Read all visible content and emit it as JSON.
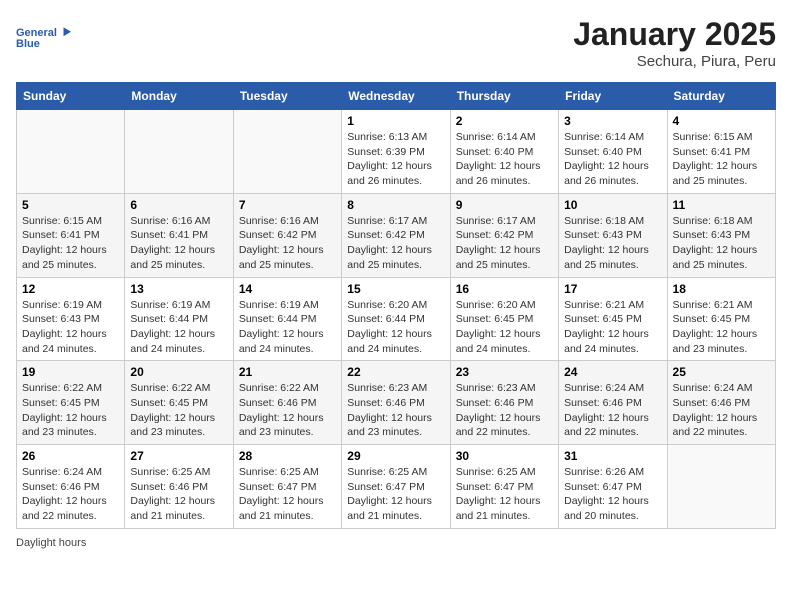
{
  "logo": {
    "line1": "General",
    "line2": "Blue"
  },
  "title": "January 2025",
  "subtitle": "Sechura, Piura, Peru",
  "weekdays": [
    "Sunday",
    "Monday",
    "Tuesday",
    "Wednesday",
    "Thursday",
    "Friday",
    "Saturday"
  ],
  "footer": {
    "daylight_label": "Daylight hours"
  },
  "weeks": [
    [
      {
        "day": "",
        "sunrise": "",
        "sunset": "",
        "daylight": ""
      },
      {
        "day": "",
        "sunrise": "",
        "sunset": "",
        "daylight": ""
      },
      {
        "day": "",
        "sunrise": "",
        "sunset": "",
        "daylight": ""
      },
      {
        "day": "1",
        "sunrise": "Sunrise: 6:13 AM",
        "sunset": "Sunset: 6:39 PM",
        "daylight": "Daylight: 12 hours and 26 minutes."
      },
      {
        "day": "2",
        "sunrise": "Sunrise: 6:14 AM",
        "sunset": "Sunset: 6:40 PM",
        "daylight": "Daylight: 12 hours and 26 minutes."
      },
      {
        "day": "3",
        "sunrise": "Sunrise: 6:14 AM",
        "sunset": "Sunset: 6:40 PM",
        "daylight": "Daylight: 12 hours and 26 minutes."
      },
      {
        "day": "4",
        "sunrise": "Sunrise: 6:15 AM",
        "sunset": "Sunset: 6:41 PM",
        "daylight": "Daylight: 12 hours and 25 minutes."
      }
    ],
    [
      {
        "day": "5",
        "sunrise": "Sunrise: 6:15 AM",
        "sunset": "Sunset: 6:41 PM",
        "daylight": "Daylight: 12 hours and 25 minutes."
      },
      {
        "day": "6",
        "sunrise": "Sunrise: 6:16 AM",
        "sunset": "Sunset: 6:41 PM",
        "daylight": "Daylight: 12 hours and 25 minutes."
      },
      {
        "day": "7",
        "sunrise": "Sunrise: 6:16 AM",
        "sunset": "Sunset: 6:42 PM",
        "daylight": "Daylight: 12 hours and 25 minutes."
      },
      {
        "day": "8",
        "sunrise": "Sunrise: 6:17 AM",
        "sunset": "Sunset: 6:42 PM",
        "daylight": "Daylight: 12 hours and 25 minutes."
      },
      {
        "day": "9",
        "sunrise": "Sunrise: 6:17 AM",
        "sunset": "Sunset: 6:42 PM",
        "daylight": "Daylight: 12 hours and 25 minutes."
      },
      {
        "day": "10",
        "sunrise": "Sunrise: 6:18 AM",
        "sunset": "Sunset: 6:43 PM",
        "daylight": "Daylight: 12 hours and 25 minutes."
      },
      {
        "day": "11",
        "sunrise": "Sunrise: 6:18 AM",
        "sunset": "Sunset: 6:43 PM",
        "daylight": "Daylight: 12 hours and 25 minutes."
      }
    ],
    [
      {
        "day": "12",
        "sunrise": "Sunrise: 6:19 AM",
        "sunset": "Sunset: 6:43 PM",
        "daylight": "Daylight: 12 hours and 24 minutes."
      },
      {
        "day": "13",
        "sunrise": "Sunrise: 6:19 AM",
        "sunset": "Sunset: 6:44 PM",
        "daylight": "Daylight: 12 hours and 24 minutes."
      },
      {
        "day": "14",
        "sunrise": "Sunrise: 6:19 AM",
        "sunset": "Sunset: 6:44 PM",
        "daylight": "Daylight: 12 hours and 24 minutes."
      },
      {
        "day": "15",
        "sunrise": "Sunrise: 6:20 AM",
        "sunset": "Sunset: 6:44 PM",
        "daylight": "Daylight: 12 hours and 24 minutes."
      },
      {
        "day": "16",
        "sunrise": "Sunrise: 6:20 AM",
        "sunset": "Sunset: 6:45 PM",
        "daylight": "Daylight: 12 hours and 24 minutes."
      },
      {
        "day": "17",
        "sunrise": "Sunrise: 6:21 AM",
        "sunset": "Sunset: 6:45 PM",
        "daylight": "Daylight: 12 hours and 24 minutes."
      },
      {
        "day": "18",
        "sunrise": "Sunrise: 6:21 AM",
        "sunset": "Sunset: 6:45 PM",
        "daylight": "Daylight: 12 hours and 23 minutes."
      }
    ],
    [
      {
        "day": "19",
        "sunrise": "Sunrise: 6:22 AM",
        "sunset": "Sunset: 6:45 PM",
        "daylight": "Daylight: 12 hours and 23 minutes."
      },
      {
        "day": "20",
        "sunrise": "Sunrise: 6:22 AM",
        "sunset": "Sunset: 6:45 PM",
        "daylight": "Daylight: 12 hours and 23 minutes."
      },
      {
        "day": "21",
        "sunrise": "Sunrise: 6:22 AM",
        "sunset": "Sunset: 6:46 PM",
        "daylight": "Daylight: 12 hours and 23 minutes."
      },
      {
        "day": "22",
        "sunrise": "Sunrise: 6:23 AM",
        "sunset": "Sunset: 6:46 PM",
        "daylight": "Daylight: 12 hours and 23 minutes."
      },
      {
        "day": "23",
        "sunrise": "Sunrise: 6:23 AM",
        "sunset": "Sunset: 6:46 PM",
        "daylight": "Daylight: 12 hours and 22 minutes."
      },
      {
        "day": "24",
        "sunrise": "Sunrise: 6:24 AM",
        "sunset": "Sunset: 6:46 PM",
        "daylight": "Daylight: 12 hours and 22 minutes."
      },
      {
        "day": "25",
        "sunrise": "Sunrise: 6:24 AM",
        "sunset": "Sunset: 6:46 PM",
        "daylight": "Daylight: 12 hours and 22 minutes."
      }
    ],
    [
      {
        "day": "26",
        "sunrise": "Sunrise: 6:24 AM",
        "sunset": "Sunset: 6:46 PM",
        "daylight": "Daylight: 12 hours and 22 minutes."
      },
      {
        "day": "27",
        "sunrise": "Sunrise: 6:25 AM",
        "sunset": "Sunset: 6:46 PM",
        "daylight": "Daylight: 12 hours and 21 minutes."
      },
      {
        "day": "28",
        "sunrise": "Sunrise: 6:25 AM",
        "sunset": "Sunset: 6:47 PM",
        "daylight": "Daylight: 12 hours and 21 minutes."
      },
      {
        "day": "29",
        "sunrise": "Sunrise: 6:25 AM",
        "sunset": "Sunset: 6:47 PM",
        "daylight": "Daylight: 12 hours and 21 minutes."
      },
      {
        "day": "30",
        "sunrise": "Sunrise: 6:25 AM",
        "sunset": "Sunset: 6:47 PM",
        "daylight": "Daylight: 12 hours and 21 minutes."
      },
      {
        "day": "31",
        "sunrise": "Sunrise: 6:26 AM",
        "sunset": "Sunset: 6:47 PM",
        "daylight": "Daylight: 12 hours and 20 minutes."
      },
      {
        "day": "",
        "sunrise": "",
        "sunset": "",
        "daylight": ""
      }
    ]
  ]
}
